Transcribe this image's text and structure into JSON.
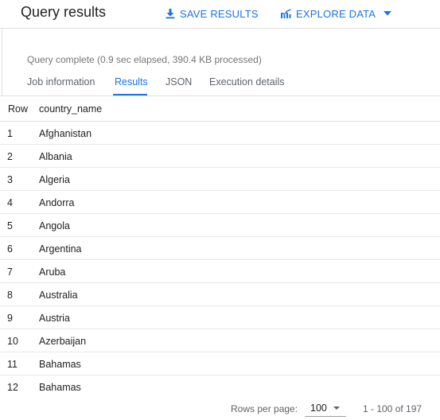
{
  "header": {
    "title": "Query results",
    "save_label": "SAVE RESULTS",
    "explore_label": "EXPLORE DATA"
  },
  "status": "Query complete (0.9 sec elapsed, 390.4 KB processed)",
  "tabs": [
    {
      "label": "Job information"
    },
    {
      "label": "Results",
      "active": true
    },
    {
      "label": "JSON"
    },
    {
      "label": "Execution details"
    }
  ],
  "table": {
    "columns": [
      "Row",
      "country_name"
    ],
    "rows": [
      {
        "row": "1",
        "country_name": "Afghanistan"
      },
      {
        "row": "2",
        "country_name": "Albania"
      },
      {
        "row": "3",
        "country_name": "Algeria"
      },
      {
        "row": "4",
        "country_name": "Andorra"
      },
      {
        "row": "5",
        "country_name": "Angola"
      },
      {
        "row": "6",
        "country_name": "Argentina"
      },
      {
        "row": "7",
        "country_name": "Aruba"
      },
      {
        "row": "8",
        "country_name": "Australia"
      },
      {
        "row": "9",
        "country_name": "Austria"
      },
      {
        "row": "10",
        "country_name": "Azerbaijan"
      },
      {
        "row": "11",
        "country_name": "Bahamas"
      },
      {
        "row": "12",
        "country_name": "Bahamas"
      }
    ]
  },
  "pagination": {
    "rows_per_page_label": "Rows per page:",
    "rows_per_page_value": "100",
    "range": "1 - 100 of 197"
  },
  "colors": {
    "accent": "#1a73e8",
    "text": "#202124",
    "muted": "#757575"
  }
}
